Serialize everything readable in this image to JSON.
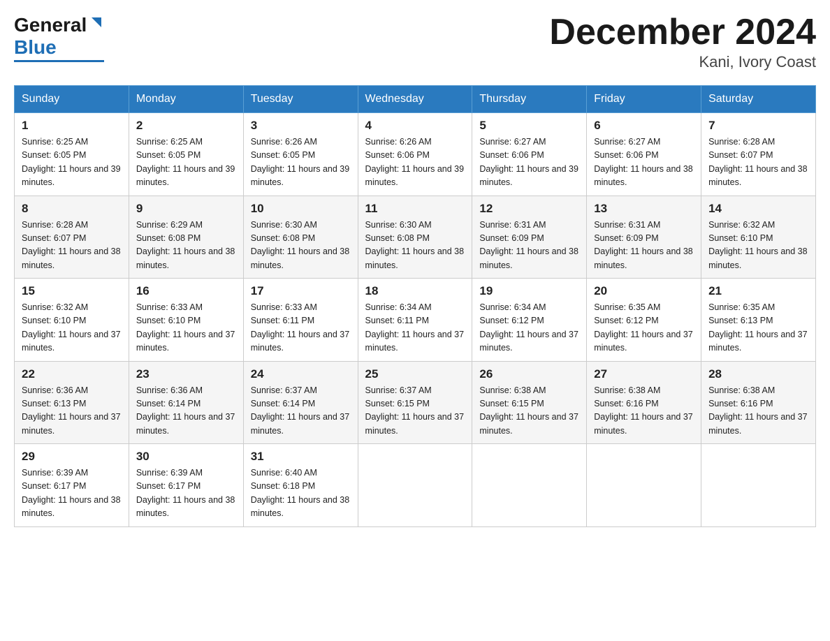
{
  "header": {
    "logo": {
      "general_text": "General",
      "blue_text": "Blue"
    },
    "title": "December 2024",
    "location": "Kani, Ivory Coast"
  },
  "calendar": {
    "days_of_week": [
      "Sunday",
      "Monday",
      "Tuesday",
      "Wednesday",
      "Thursday",
      "Friday",
      "Saturday"
    ],
    "weeks": [
      [
        {
          "day": "1",
          "sunrise": "6:25 AM",
          "sunset": "6:05 PM",
          "daylight": "11 hours and 39 minutes."
        },
        {
          "day": "2",
          "sunrise": "6:25 AM",
          "sunset": "6:05 PM",
          "daylight": "11 hours and 39 minutes."
        },
        {
          "day": "3",
          "sunrise": "6:26 AM",
          "sunset": "6:05 PM",
          "daylight": "11 hours and 39 minutes."
        },
        {
          "day": "4",
          "sunrise": "6:26 AM",
          "sunset": "6:06 PM",
          "daylight": "11 hours and 39 minutes."
        },
        {
          "day": "5",
          "sunrise": "6:27 AM",
          "sunset": "6:06 PM",
          "daylight": "11 hours and 39 minutes."
        },
        {
          "day": "6",
          "sunrise": "6:27 AM",
          "sunset": "6:06 PM",
          "daylight": "11 hours and 38 minutes."
        },
        {
          "day": "7",
          "sunrise": "6:28 AM",
          "sunset": "6:07 PM",
          "daylight": "11 hours and 38 minutes."
        }
      ],
      [
        {
          "day": "8",
          "sunrise": "6:28 AM",
          "sunset": "6:07 PM",
          "daylight": "11 hours and 38 minutes."
        },
        {
          "day": "9",
          "sunrise": "6:29 AM",
          "sunset": "6:08 PM",
          "daylight": "11 hours and 38 minutes."
        },
        {
          "day": "10",
          "sunrise": "6:30 AM",
          "sunset": "6:08 PM",
          "daylight": "11 hours and 38 minutes."
        },
        {
          "day": "11",
          "sunrise": "6:30 AM",
          "sunset": "6:08 PM",
          "daylight": "11 hours and 38 minutes."
        },
        {
          "day": "12",
          "sunrise": "6:31 AM",
          "sunset": "6:09 PM",
          "daylight": "11 hours and 38 minutes."
        },
        {
          "day": "13",
          "sunrise": "6:31 AM",
          "sunset": "6:09 PM",
          "daylight": "11 hours and 38 minutes."
        },
        {
          "day": "14",
          "sunrise": "6:32 AM",
          "sunset": "6:10 PM",
          "daylight": "11 hours and 38 minutes."
        }
      ],
      [
        {
          "day": "15",
          "sunrise": "6:32 AM",
          "sunset": "6:10 PM",
          "daylight": "11 hours and 37 minutes."
        },
        {
          "day": "16",
          "sunrise": "6:33 AM",
          "sunset": "6:10 PM",
          "daylight": "11 hours and 37 minutes."
        },
        {
          "day": "17",
          "sunrise": "6:33 AM",
          "sunset": "6:11 PM",
          "daylight": "11 hours and 37 minutes."
        },
        {
          "day": "18",
          "sunrise": "6:34 AM",
          "sunset": "6:11 PM",
          "daylight": "11 hours and 37 minutes."
        },
        {
          "day": "19",
          "sunrise": "6:34 AM",
          "sunset": "6:12 PM",
          "daylight": "11 hours and 37 minutes."
        },
        {
          "day": "20",
          "sunrise": "6:35 AM",
          "sunset": "6:12 PM",
          "daylight": "11 hours and 37 minutes."
        },
        {
          "day": "21",
          "sunrise": "6:35 AM",
          "sunset": "6:13 PM",
          "daylight": "11 hours and 37 minutes."
        }
      ],
      [
        {
          "day": "22",
          "sunrise": "6:36 AM",
          "sunset": "6:13 PM",
          "daylight": "11 hours and 37 minutes."
        },
        {
          "day": "23",
          "sunrise": "6:36 AM",
          "sunset": "6:14 PM",
          "daylight": "11 hours and 37 minutes."
        },
        {
          "day": "24",
          "sunrise": "6:37 AM",
          "sunset": "6:14 PM",
          "daylight": "11 hours and 37 minutes."
        },
        {
          "day": "25",
          "sunrise": "6:37 AM",
          "sunset": "6:15 PM",
          "daylight": "11 hours and 37 minutes."
        },
        {
          "day": "26",
          "sunrise": "6:38 AM",
          "sunset": "6:15 PM",
          "daylight": "11 hours and 37 minutes."
        },
        {
          "day": "27",
          "sunrise": "6:38 AM",
          "sunset": "6:16 PM",
          "daylight": "11 hours and 37 minutes."
        },
        {
          "day": "28",
          "sunrise": "6:38 AM",
          "sunset": "6:16 PM",
          "daylight": "11 hours and 37 minutes."
        }
      ],
      [
        {
          "day": "29",
          "sunrise": "6:39 AM",
          "sunset": "6:17 PM",
          "daylight": "11 hours and 38 minutes."
        },
        {
          "day": "30",
          "sunrise": "6:39 AM",
          "sunset": "6:17 PM",
          "daylight": "11 hours and 38 minutes."
        },
        {
          "day": "31",
          "sunrise": "6:40 AM",
          "sunset": "6:18 PM",
          "daylight": "11 hours and 38 minutes."
        },
        null,
        null,
        null,
        null
      ]
    ]
  }
}
